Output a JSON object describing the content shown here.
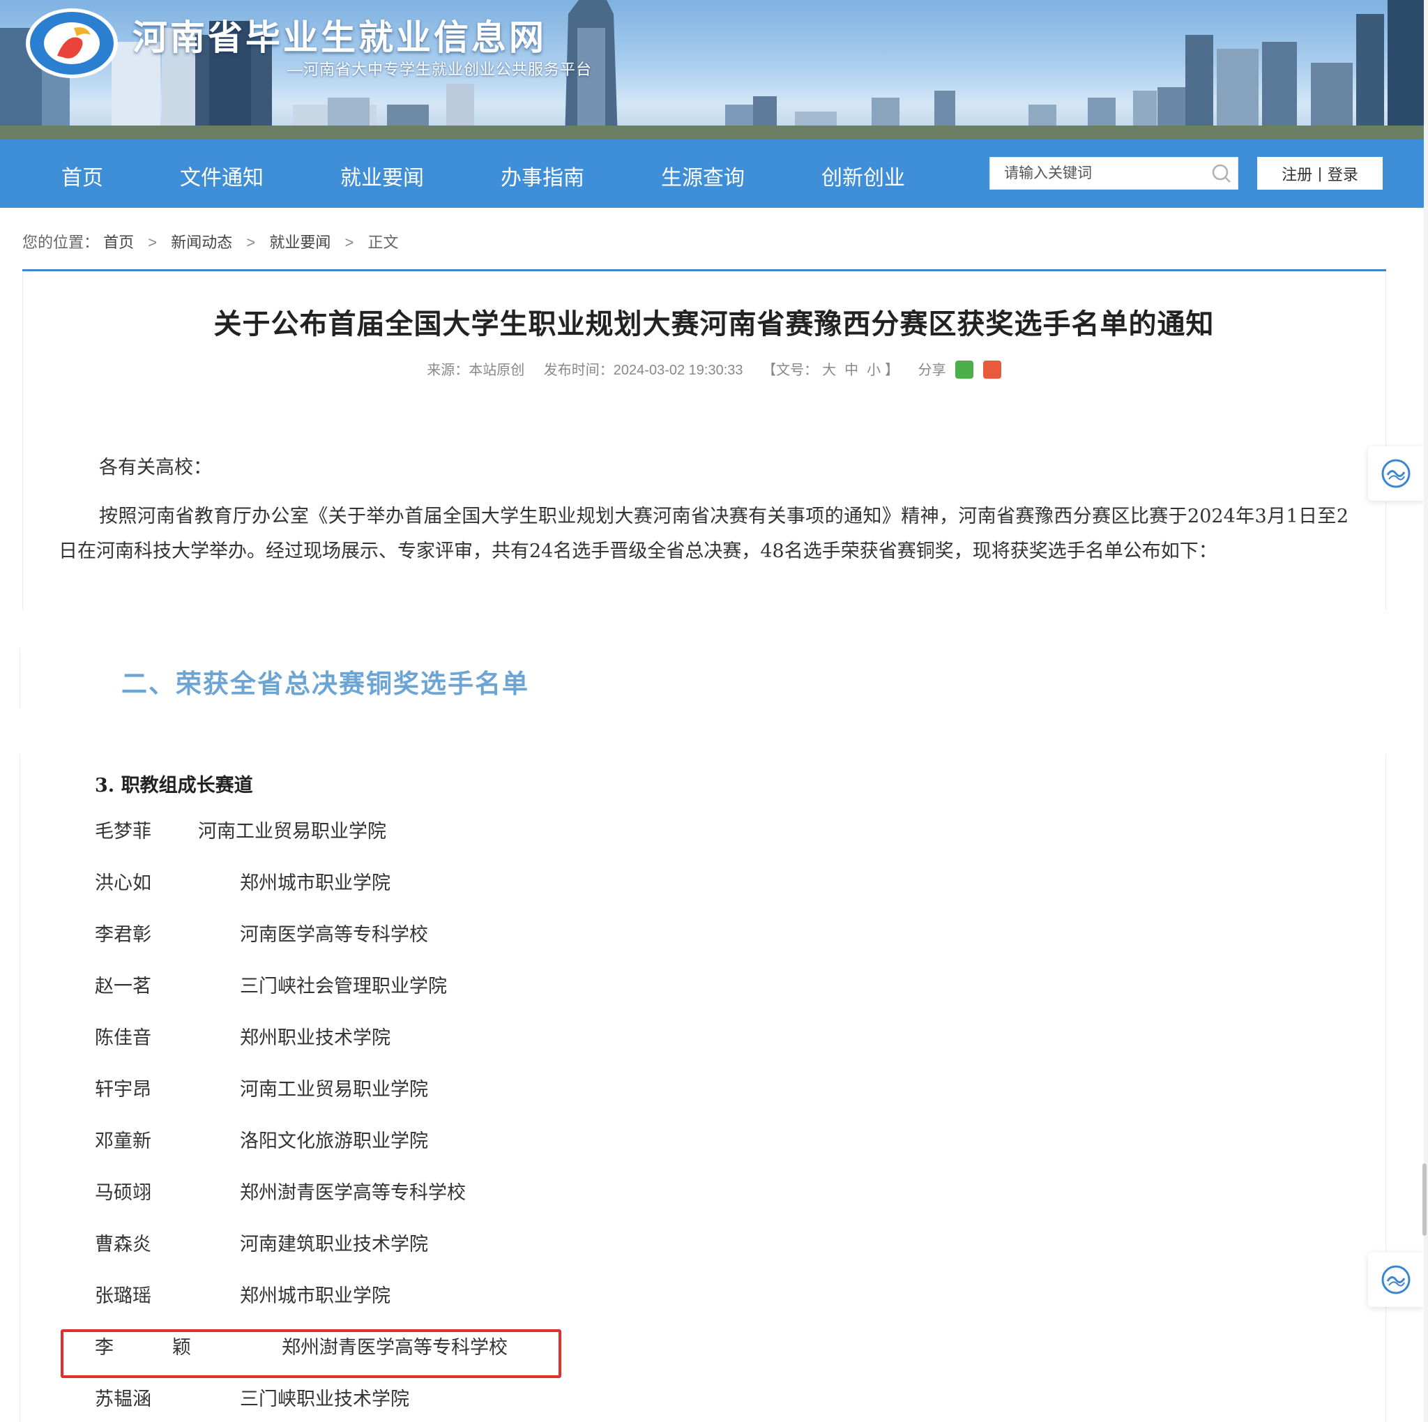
{
  "site": {
    "title": "河南省毕业生就业信息网",
    "subtitle": "—河南省大中专学生就业创业公共服务平台"
  },
  "nav": {
    "items": [
      {
        "label": "首页"
      },
      {
        "label": "文件通知"
      },
      {
        "label": "就业要闻"
      },
      {
        "label": "办事指南"
      },
      {
        "label": "生源查询"
      },
      {
        "label": "创新创业"
      }
    ],
    "search_placeholder": "请输入关键词",
    "register_label": "注册",
    "separator": "|",
    "login_label": "登录"
  },
  "breadcrumb": {
    "prefix": "您的位置：",
    "items": [
      "首页",
      "新闻动态",
      "就业要闻",
      "正文"
    ],
    "separator": ">"
  },
  "article": {
    "title": "关于公布首届全国大学生职业规划大赛河南省赛豫西分赛区获奖选手名单的通知",
    "source_label": "来源：本站原创",
    "published_label": "发布时间：2024-03-02 19:30:33",
    "font_size_prefix": "【文号：",
    "font_size_options": [
      "大",
      "中",
      "小"
    ],
    "font_size_suffix": "】",
    "share_label": "分享",
    "greeting": "各有关高校：",
    "paragraph": "按照河南省教育厅办公室《关于举办首届全国大学生职业规划大赛河南省决赛有关事项的通知》精神，河南省赛豫西分赛区比赛于2024年3月1日至2日在河南科技大学举办。经过现场展示、专家评审，共有24名选手晋级全省总决赛，48名选手荣获省赛铜奖，现将获奖选手名单公布如下："
  },
  "section": {
    "heading": "二、荣获全省总决赛铜奖选手名单",
    "subheading": "3. 职教组成长赛道",
    "winners": [
      {
        "name": "毛梦菲",
        "school": "河南工业贸易职业学院"
      },
      {
        "name": "洪心如",
        "school": "郑州城市职业学院"
      },
      {
        "name": "李君彰",
        "school": "河南医学高等专科学校"
      },
      {
        "name": "赵一茗",
        "school": "三门峡社会管理职业学院"
      },
      {
        "name": "陈佳音",
        "school": "郑州职业技术学院"
      },
      {
        "name": "轩宇昂",
        "school": "河南工业贸易职业学院"
      },
      {
        "name": "邓童新",
        "school": "洛阳文化旅游职业学院"
      },
      {
        "name": "马硕翊",
        "school": "郑州澍青医学高等专科学校"
      },
      {
        "name": "曹森炎",
        "school": "河南建筑职业技术学院"
      },
      {
        "name": "张璐瑶",
        "school": "郑州城市职业学院"
      },
      {
        "name": "李颖",
        "school": "郑州澍青医学高等专科学校"
      },
      {
        "name": "苏韫涵",
        "school": "三门峡职业技术学院"
      }
    ]
  },
  "colors": {
    "nav_bg": "#3f8fd8",
    "accent_rule": "#3b86cf",
    "section_heading": "#6ca4d3",
    "highlight_border": "#e0302d"
  }
}
